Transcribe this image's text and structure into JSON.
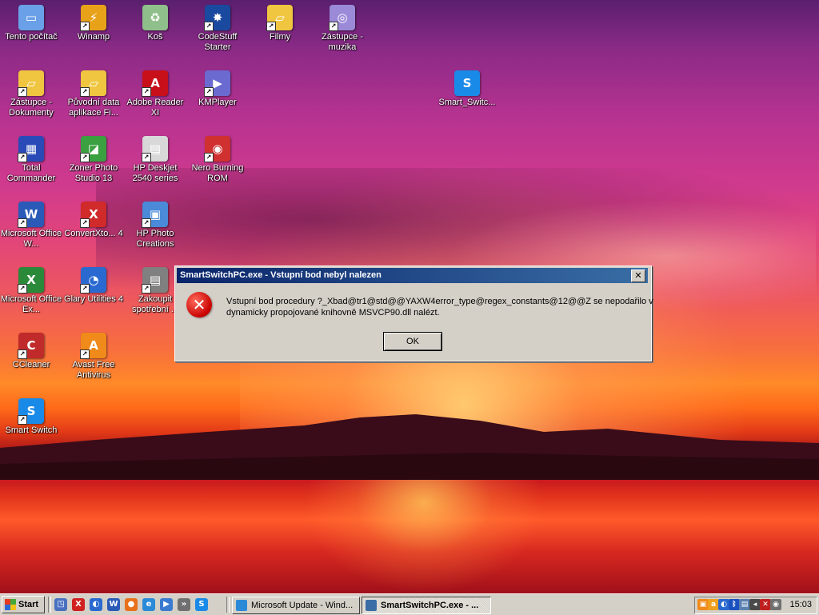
{
  "desktop": {
    "icons": [
      {
        "label": "Tento počítač",
        "icon": "computer-icon",
        "color": "#6aa0e8"
      },
      {
        "label": "Winamp",
        "icon": "winamp-icon",
        "color": "#e8a21a"
      },
      {
        "label": "Koš",
        "icon": "recycle-bin-icon",
        "color": "#8fbf8a"
      },
      {
        "label": "CodeStuff Starter",
        "icon": "codestuff-starter-icon",
        "color": "#1a4aa0"
      },
      {
        "label": "Filmy",
        "icon": "folder-icon",
        "color": "#f0c640"
      },
      {
        "label": "Zástupce - muzika",
        "icon": "music-disc-icon",
        "color": "#9a8ad8"
      },
      {
        "label": "Zástupce - Dokumenty",
        "icon": "documents-folder-icon",
        "color": "#f0c640"
      },
      {
        "label": "Původní data aplikace Fi...",
        "icon": "folder-icon",
        "color": "#f0c640"
      },
      {
        "label": "Adobe Reader XI",
        "icon": "adobe-reader-icon",
        "color": "#c8101a"
      },
      {
        "label": "KMPlayer",
        "icon": "kmplayer-icon",
        "color": "#6a6ad0"
      },
      {
        "label": "Smart_Switc...",
        "icon": "smart-switch-icon",
        "color": "#1a8ae8"
      },
      {
        "label": "Total Commander",
        "icon": "floppy-disk-icon",
        "color": "#2a4ab8"
      },
      {
        "label": "Zoner Photo Studio 13",
        "icon": "zoner-photo-icon",
        "color": "#3aa040"
      },
      {
        "label": "HP Deskjet 2540 series",
        "icon": "printer-icon",
        "color": "#d8d8d8"
      },
      {
        "label": "Nero Burning ROM",
        "icon": "nero-icon",
        "color": "#d03030"
      },
      {
        "label": "Microsoft Office W...",
        "icon": "word-icon",
        "color": "#2a5ab8"
      },
      {
        "label": "ConvertXto... 4",
        "icon": "convertxtodvd-icon",
        "color": "#d02a2a"
      },
      {
        "label": "HP Photo Creations",
        "icon": "hp-photo-icon",
        "color": "#4a8ad8"
      },
      {
        "label": "Microsoft Office Ex...",
        "icon": "excel-icon",
        "color": "#2a8a3a"
      },
      {
        "label": "Glary Utilities 4",
        "icon": "glary-utilities-icon",
        "color": "#2a6ad0"
      },
      {
        "label": "Zakoupit spotřební ...",
        "icon": "hp-supplies-icon",
        "color": "#808080"
      },
      {
        "label": "CCleaner",
        "icon": "ccleaner-icon",
        "color": "#c02a2a"
      },
      {
        "label": "Avast Free Antivirus",
        "icon": "avast-icon",
        "color": "#f08a1a"
      },
      {
        "label": "Smart Switch",
        "icon": "smart-switch-icon",
        "color": "#1a8ae8"
      }
    ]
  },
  "dialog": {
    "title": "SmartSwitchPC.exe - Vstupní bod nebyl nalezen",
    "close_label": "✕",
    "message_line1": "Vstupní bod procedury ?_Xbad@tr1@std@@YAXW4error_type@regex_constants@12@@Z se nepodařilo v",
    "message_line2": "dynamicky propojované knihovně MSVCP90.dll nalézt.",
    "ok_label": "OK",
    "error_icon_glyph": "✕"
  },
  "taskbar": {
    "start_label": "Start",
    "quick_launch": [
      {
        "icon": "show-desktop-icon",
        "glyph": "◳",
        "color": "#4a70c0"
      },
      {
        "icon": "convertxtodvd-icon",
        "glyph": "X",
        "color": "#d02020"
      },
      {
        "icon": "glary-utilities-icon",
        "glyph": "◐",
        "color": "#2a6ad0"
      },
      {
        "icon": "word-icon",
        "glyph": "W",
        "color": "#2a5ab8"
      },
      {
        "icon": "firefox-icon",
        "glyph": "●",
        "color": "#e8701a"
      },
      {
        "icon": "internet-explorer-icon",
        "glyph": "e",
        "color": "#2a8ad8"
      },
      {
        "icon": "media-player-icon",
        "glyph": "▶",
        "color": "#3a7ad0"
      },
      {
        "icon": "quick-launch-expand-icon",
        "glyph": "»",
        "color": "#707070"
      },
      {
        "icon": "smart-switch-icon",
        "glyph": "S",
        "color": "#1a8ae8"
      }
    ],
    "tasks": [
      {
        "label": "Microsoft Update - Wind...",
        "icon": "internet-explorer-icon",
        "color": "#2a8ad8",
        "active": false
      },
      {
        "label": "SmartSwitchPC.exe - ...",
        "icon": "application-window-icon",
        "color": "#3a6ea5",
        "active": true
      }
    ],
    "tray": [
      {
        "icon": "tray-app-icon",
        "glyph": "▣",
        "color": "#f08a1a"
      },
      {
        "icon": "avast-tray-icon",
        "glyph": "a",
        "color": "#f0a020"
      },
      {
        "icon": "tray-app-icon",
        "glyph": "◐",
        "color": "#2a6ad0"
      },
      {
        "icon": "bluetooth-icon",
        "glyph": "ᛒ",
        "color": "#1a50c0"
      },
      {
        "icon": "network-icon",
        "glyph": "▤",
        "color": "#5a80b0"
      },
      {
        "icon": "volume-icon",
        "glyph": "◂",
        "color": "#4a4a4a"
      },
      {
        "icon": "network-disconnected-icon",
        "glyph": "✕",
        "color": "#c02020"
      },
      {
        "icon": "tray-app-icon",
        "glyph": "◉",
        "color": "#707070"
      }
    ],
    "clock": "15:03"
  }
}
